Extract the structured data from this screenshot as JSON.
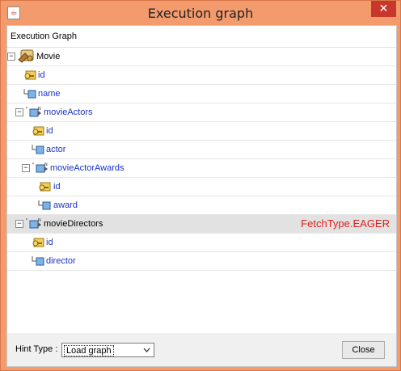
{
  "window": {
    "title": "Execution graph",
    "close_glyph": "✕",
    "app_icon": "☕"
  },
  "panel": {
    "header": "Execution Graph"
  },
  "tree": [
    {
      "label": "Movie",
      "icon": "entity-icon",
      "toggle": "minus"
    },
    {
      "label": "id",
      "icon": "key-icon"
    },
    {
      "label": "name",
      "icon": "attribute-icon"
    },
    {
      "label": "movieActors",
      "icon": "relation-icon",
      "toggle": "minus"
    },
    {
      "label": "id",
      "icon": "key-icon"
    },
    {
      "label": "actor",
      "icon": "attribute-icon"
    },
    {
      "label": "movieActorAwards",
      "icon": "relation-icon",
      "toggle": "minus"
    },
    {
      "label": "id",
      "icon": "key-icon"
    },
    {
      "label": "award",
      "icon": "attribute-icon"
    },
    {
      "label": "movieDirectors",
      "icon": "relation-icon",
      "toggle": "minus",
      "selected": true,
      "note": "FetchType.EAGER"
    },
    {
      "label": "id",
      "icon": "key-icon"
    },
    {
      "label": "director",
      "icon": "attribute-icon"
    }
  ],
  "footer": {
    "hint_label": "Hint Type :",
    "hint_value": "Load graph",
    "close_label": "Close"
  },
  "colors": {
    "window_frame": "#f49b6d",
    "note": "#e0201b",
    "link": "#1a32c8",
    "close_button": "#c7372c"
  }
}
